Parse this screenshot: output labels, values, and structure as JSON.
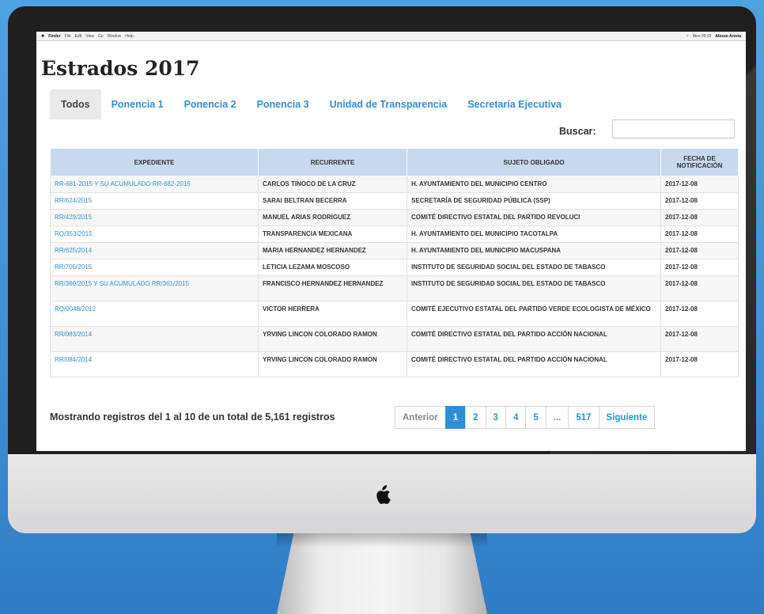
{
  "menubar": {
    "apple": "",
    "items": [
      "Finder",
      "File",
      "Edit",
      "View",
      "Go",
      "Window",
      "Help"
    ],
    "clock": "Mon 09:32",
    "user": "Alesso Arzeia"
  },
  "page": {
    "title": "Estrados 2017",
    "tabs": [
      "Todos",
      "Ponencia 1",
      "Ponencia 2",
      "Ponencia 3",
      "Unidad de Transparencia",
      "Secretaría Ejecutiva"
    ],
    "active_tab": "Todos",
    "search_label": "Buscar:",
    "search_value": ""
  },
  "table": {
    "headers": [
      "EXPEDIENTE",
      "RECURRENTE",
      "SUJETO OBLIGADO",
      "FECHA DE NOTIFICACIÓN"
    ],
    "rows": [
      [
        "RR-681-2015 Y SU ACUMULADO RR-682-2015",
        "CARLOS TINOCO DE LA CRUZ",
        "H. AYUNTAMIENTO DEL MUNICIPIO CENTRO",
        "2017-12-08"
      ],
      [
        "RR/624/2015",
        "SARAI BELTRAN BECERRA",
        "SECRETARÍA DE SEGURIDAD PÚBLICA (SSP)",
        "2017-12-08"
      ],
      [
        "RR/429/2015",
        "MANUEL ARIAS RODRIGUEZ",
        "COMITÉ DIRECTIVO ESTATAL DEL PARTIDO REVOLUCI",
        "2017-12-08"
      ],
      [
        "RQ/353/2015",
        "TRANSPARENCIA MEXICANA",
        "H. AYUNTAMIENTO DEL MUNICIPIO TACOTALPA",
        "2017-12-08"
      ],
      [
        "RR/625/2014",
        "MARIA HERNANDEZ HERNANDEZ",
        "H. AYUNTAMIENTO DEL MUNICIPIO MACUSPANA",
        "2017-12-08"
      ],
      [
        "RR/705/2015",
        "LETICIA LEZAMA MOSCOSO",
        "INSTITUTO DE SEGURIDAD SOCIAL DEL ESTADO DE TABASCO",
        "2017-12-08"
      ],
      [
        "RR/360/2015 Y SU ACUMULADO RR/361/2015",
        "FRANCISCO HERNANDEZ HERNANDEZ",
        "INSTITUTO DE SEGURIDAD SOCIAL DEL ESTADO DE TABASCO",
        "2017-12-08"
      ],
      [
        "RQ/0048/2012",
        "VICTOR HERRERA",
        "COMITÉ EJECUTIVO ESTATAL DEL PARTIDO VERDE ECOLOGISTA DE MÉXICO",
        "2017-12-08"
      ],
      [
        "RR/083/2014",
        "YRVING LINCON COLORADO RAMON",
        "COMITÉ DIRECTIVO ESTATAL DEL PARTIDO ACCIÓN NACIONAL",
        "2017-12-08"
      ],
      [
        "RR/084/2014",
        "YRVING LINCON COLORADO RAMON",
        "COMITÉ DIRECTIVO ESTATAL DEL PARTIDO ACCIÓN NACIONAL",
        "2017-12-08"
      ]
    ]
  },
  "footer": {
    "info": "Mostrando registros del 1 al 10 de un total de 5,161 registros",
    "pagination": [
      "Anterior",
      "1",
      "2",
      "3",
      "4",
      "5",
      "...",
      "517",
      "Siguiente"
    ],
    "current_page": "1"
  },
  "colors": {
    "link": "#2f8fd6",
    "header_bg": "#c7d9ef",
    "background": "#3f8fd3"
  }
}
